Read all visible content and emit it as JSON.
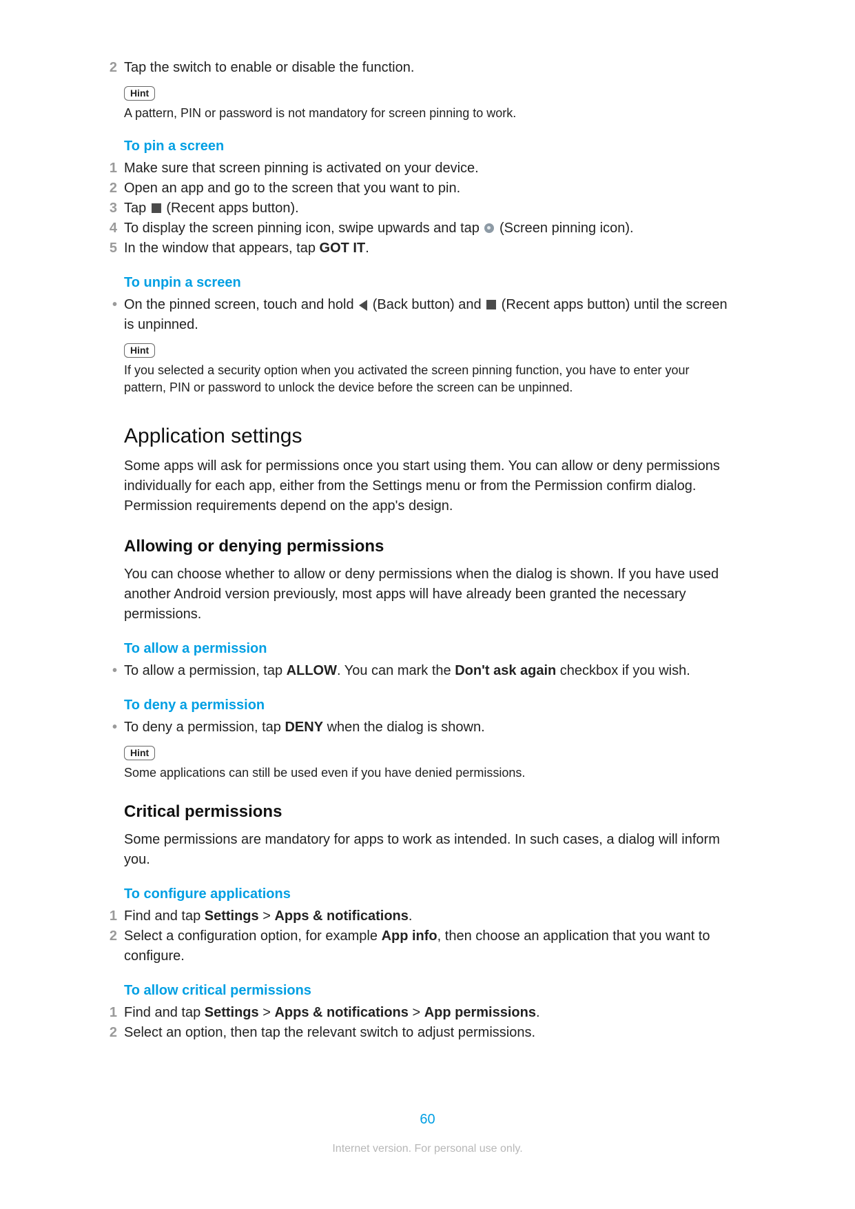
{
  "step_continue": {
    "num": "2",
    "text": "Tap the switch to enable or disable the function."
  },
  "hint_label": "Hint",
  "hint1_text": "A pattern, PIN or password is not mandatory for screen pinning to work.",
  "pin_heading": "To pin a screen",
  "pin_steps": [
    {
      "num": "1",
      "text": "Make sure that screen pinning is activated on your device."
    },
    {
      "num": "2",
      "text": "Open an app and go to the screen that you want to pin."
    },
    {
      "num": "3",
      "pre": "Tap ",
      "suffix": " (Recent apps button)."
    },
    {
      "num": "4",
      "pre": "To display the screen pinning icon, swipe upwards and tap ",
      "suffix": " (Screen pinning icon)."
    },
    {
      "num": "5",
      "pre": "In the window that appears, tap ",
      "bold": "GOT IT",
      "post": "."
    }
  ],
  "unpin_heading": "To unpin a screen",
  "unpin_bullet": {
    "pre": "On the pinned screen, touch and hold ",
    "mid1": " (Back button) and ",
    "mid2": " (Recent apps button) until the screen is unpinned."
  },
  "hint2_text": "If you selected a security option when you activated the screen pinning function, you have to enter your pattern, PIN or password to unlock the device before the screen can be unpinned.",
  "app_settings_heading": "Application settings",
  "app_settings_p": "Some apps will ask for permissions once you start using them. You can allow or deny permissions individually for each app, either from the Settings menu or from the Permission confirm dialog. Permission requirements depend on the app's design.",
  "allow_deny_heading": "Allowing or denying permissions",
  "allow_deny_p": "You can choose whether to allow or deny permissions when the dialog is shown. If you have used another Android version previously, most apps will have already been granted the necessary permissions.",
  "to_allow_heading": "To allow a permission",
  "to_allow_bullet": {
    "pre": "To allow a permission, tap ",
    "bold1": "ALLOW",
    "mid": ". You can mark the ",
    "bold2": "Don't ask again",
    "post": " checkbox if you wish."
  },
  "to_deny_heading": "To deny a permission",
  "to_deny_bullet": {
    "pre": "To deny a permission, tap ",
    "bold": "DENY",
    "post": " when the dialog is shown."
  },
  "hint3_text": "Some applications can still be used even if you have denied permissions.",
  "critical_heading": "Critical permissions",
  "critical_p": "Some permissions are mandatory for apps to work as intended. In such cases, a dialog will inform you.",
  "configure_heading": "To configure applications",
  "configure_steps": {
    "s1": {
      "num": "1",
      "pre": "Find and tap ",
      "b1": "Settings",
      "gt": " > ",
      "b2": "Apps & notifications",
      "post": "."
    },
    "s2": {
      "num": "2",
      "pre": "Select a configuration option, for example ",
      "b1": "App info",
      "post": ", then choose an application that you want to configure."
    }
  },
  "allow_crit_heading": "To allow critical permissions",
  "allow_crit_steps": {
    "s1": {
      "num": "1",
      "pre": "Find and tap ",
      "b1": "Settings",
      "gt": " > ",
      "b2": "Apps & notifications",
      "gt2": " > ",
      "b3": "App permissions",
      "post": "."
    },
    "s2": {
      "num": "2",
      "text": "Select an option, then tap the relevant switch to adjust permissions."
    }
  },
  "page_number": "60",
  "footer": "Internet version. For personal use only."
}
